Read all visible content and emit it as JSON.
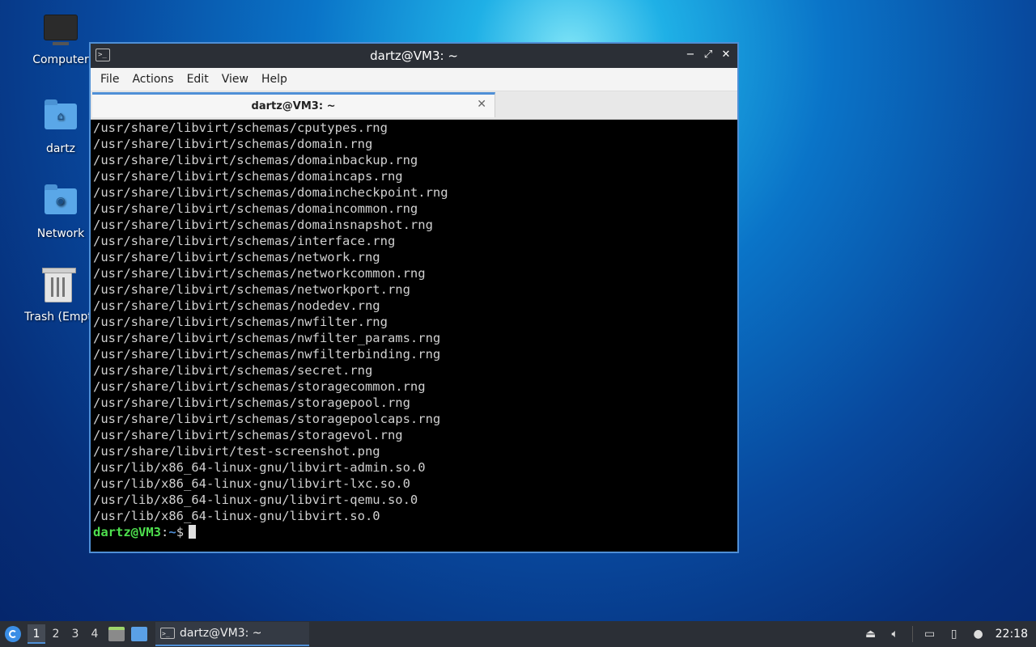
{
  "desktop": {
    "icons": [
      {
        "label": "Computer",
        "icon": "computer-icon"
      },
      {
        "label": "dartz",
        "icon": "home-folder-icon"
      },
      {
        "label": "Network",
        "icon": "network-folder-icon"
      },
      {
        "label": "Trash (Empt",
        "icon": "trash-icon"
      }
    ]
  },
  "window": {
    "title": "dartz@VM3: ~",
    "controls": {
      "minimize": "−",
      "maximize": "⤢",
      "close": "✕"
    },
    "menu": [
      "File",
      "Actions",
      "Edit",
      "View",
      "Help"
    ],
    "tab": {
      "label": "dartz@VM3: ~",
      "close": "✕"
    }
  },
  "terminal": {
    "lines": [
      "/usr/share/libvirt/schemas/cputypes.rng",
      "/usr/share/libvirt/schemas/domain.rng",
      "/usr/share/libvirt/schemas/domainbackup.rng",
      "/usr/share/libvirt/schemas/domaincaps.rng",
      "/usr/share/libvirt/schemas/domaincheckpoint.rng",
      "/usr/share/libvirt/schemas/domaincommon.rng",
      "/usr/share/libvirt/schemas/domainsnapshot.rng",
      "/usr/share/libvirt/schemas/interface.rng",
      "/usr/share/libvirt/schemas/network.rng",
      "/usr/share/libvirt/schemas/networkcommon.rng",
      "/usr/share/libvirt/schemas/networkport.rng",
      "/usr/share/libvirt/schemas/nodedev.rng",
      "/usr/share/libvirt/schemas/nwfilter.rng",
      "/usr/share/libvirt/schemas/nwfilter_params.rng",
      "/usr/share/libvirt/schemas/nwfilterbinding.rng",
      "/usr/share/libvirt/schemas/secret.rng",
      "/usr/share/libvirt/schemas/storagecommon.rng",
      "/usr/share/libvirt/schemas/storagepool.rng",
      "/usr/share/libvirt/schemas/storagepoolcaps.rng",
      "/usr/share/libvirt/schemas/storagevol.rng",
      "/usr/share/libvirt/test-screenshot.png",
      "/usr/lib/x86_64-linux-gnu/libvirt-admin.so.0",
      "/usr/lib/x86_64-linux-gnu/libvirt-lxc.so.0",
      "/usr/lib/x86_64-linux-gnu/libvirt-qemu.so.0",
      "/usr/lib/x86_64-linux-gnu/libvirt.so.0"
    ],
    "prompt": {
      "user_host": "dartz@VM3",
      "colon": ":",
      "path": "~",
      "symbol": "$"
    }
  },
  "taskbar": {
    "workspaces": [
      "1",
      "2",
      "3",
      "4"
    ],
    "active_workspace": "1",
    "task_label": "dartz@VM3: ~",
    "clock": "22:18"
  }
}
